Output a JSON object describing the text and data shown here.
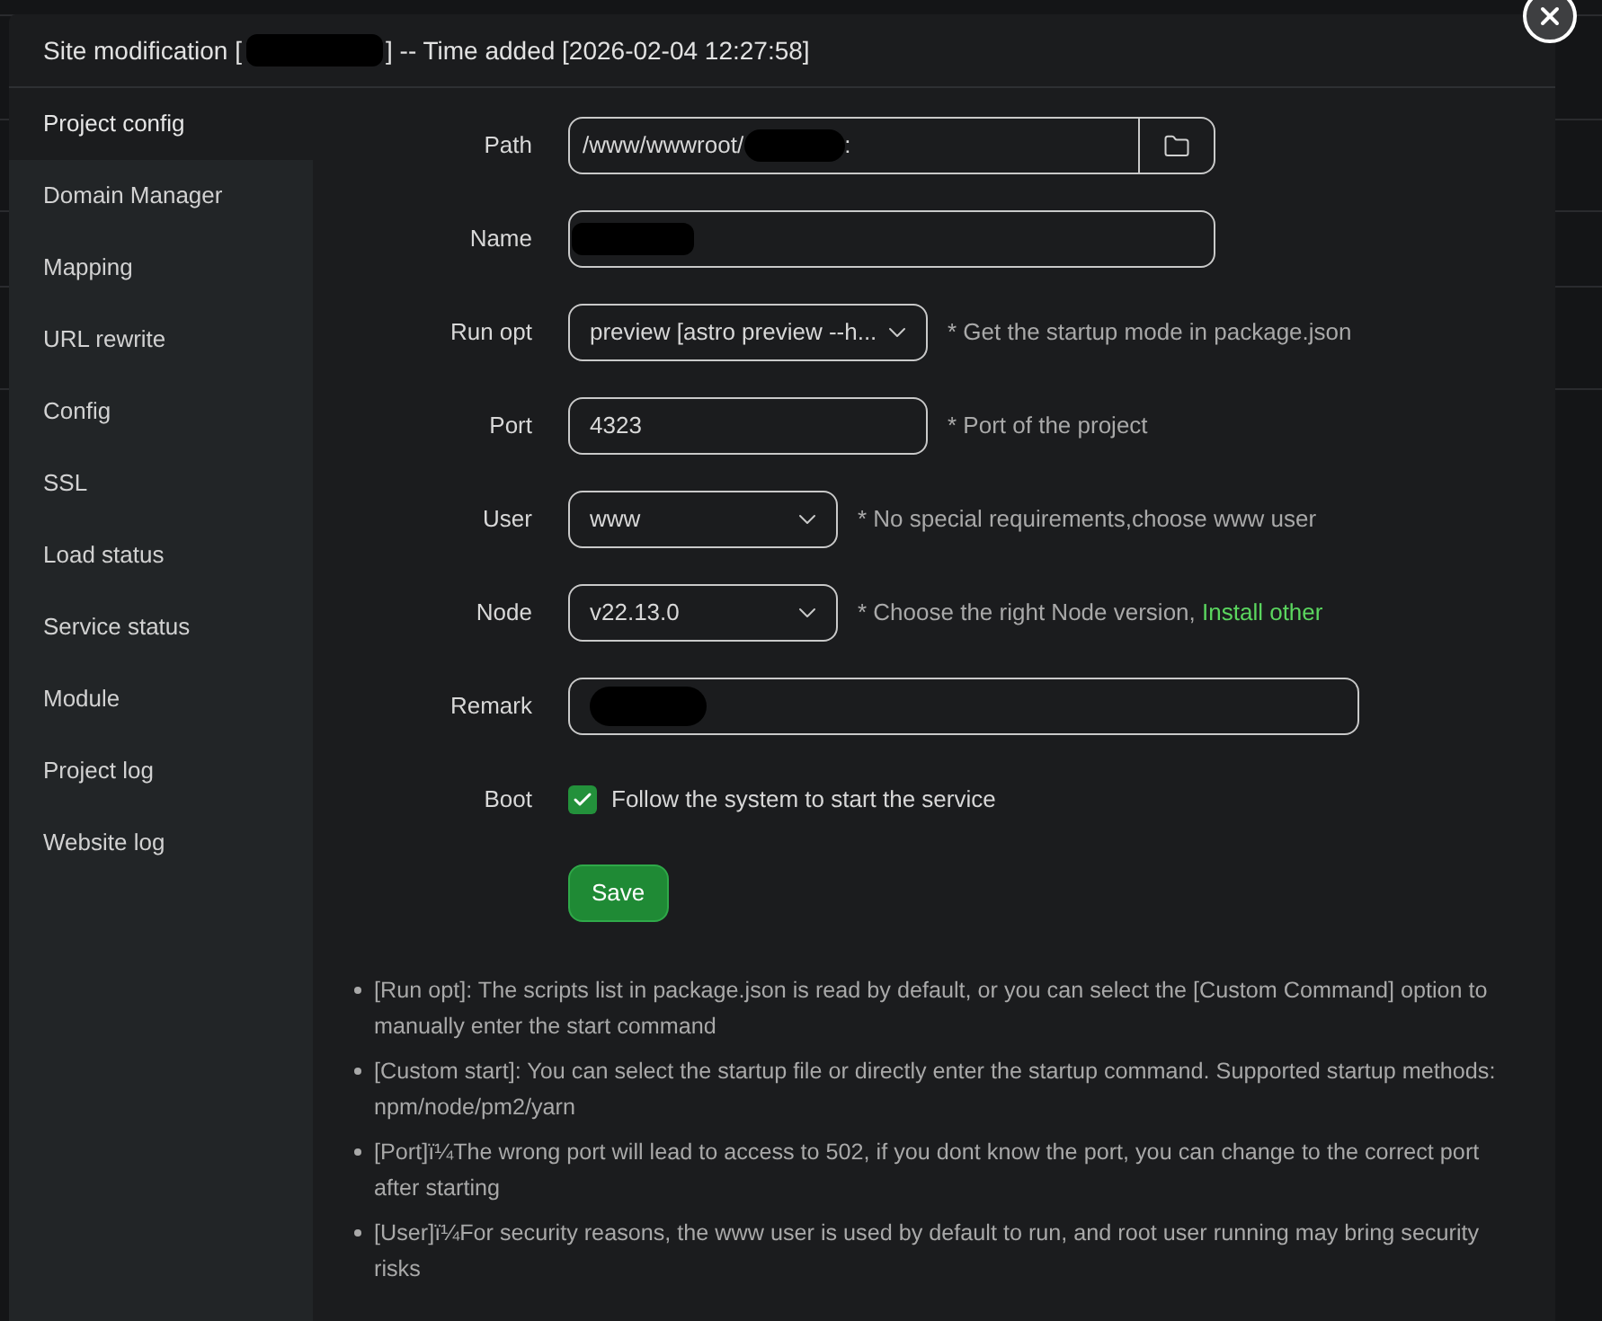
{
  "dialog": {
    "title_parts": [
      {
        "kind": "text",
        "text": "Site modification ["
      },
      {
        "kind": "redaction"
      },
      {
        "kind": "text",
        "text": "] -- Time added [2026-02-04 12:27:58]"
      }
    ]
  },
  "sidebar": {
    "items": [
      {
        "label": "Project config",
        "selected": true
      },
      {
        "label": "Domain Manager",
        "selected": false
      },
      {
        "label": "Mapping",
        "selected": false
      },
      {
        "label": "URL rewrite",
        "selected": false
      },
      {
        "label": "Config",
        "selected": false
      },
      {
        "label": "SSL",
        "selected": false
      },
      {
        "label": "Load status",
        "selected": false
      },
      {
        "label": "Service status",
        "selected": false
      },
      {
        "label": "Module",
        "selected": false
      },
      {
        "label": "Project log",
        "selected": false
      },
      {
        "label": "Website log",
        "selected": false
      }
    ]
  },
  "form": {
    "rows": [
      {
        "kind": "path",
        "label": "Path",
        "value_parts": [
          {
            "kind": "text",
            "text": "/www/wwwroot/"
          },
          {
            "kind": "redaction"
          },
          {
            "kind": "text",
            "text": ":"
          }
        ]
      },
      {
        "kind": "input",
        "label": "Name",
        "value_parts": [
          {
            "kind": "redaction"
          }
        ]
      },
      {
        "kind": "select",
        "label": "Run opt",
        "value": "preview [astro preview --h...",
        "hint": "* Get the startup mode in package.json"
      },
      {
        "kind": "input",
        "label": "Port",
        "value_parts": [
          {
            "kind": "text",
            "text": "4323"
          }
        ],
        "hint": "* Port of the project"
      },
      {
        "kind": "select",
        "label": "User",
        "value": "www",
        "hint": "* No special requirements,choose www user"
      },
      {
        "kind": "select",
        "label": "Node",
        "value": "v22.13.0",
        "hint": "* Choose the right Node version,",
        "hint_link": "Install other"
      },
      {
        "kind": "input",
        "label": "Remark",
        "value_parts": [
          {
            "kind": "redaction"
          }
        ]
      },
      {
        "kind": "checkbox",
        "label": "Boot",
        "checked": true,
        "text": "Follow the system to start the service"
      }
    ],
    "save_button": "Save"
  },
  "notes": [
    "[Run opt]: The scripts list in package.json is read by default, or you can select the [Custom Command] option to manually enter the start command",
    "[Custom start]: You can select the startup file or directly enter the startup command. Supported startup methods: npm/node/pm2/yarn",
    "[Port]ï¼The wrong port will lead to access to 502, if you dont know the port, you can change to the correct port after starting",
    "[User]ï¼For security reasons, the www user is used by default to run, and root user running may bring security risks"
  ]
}
